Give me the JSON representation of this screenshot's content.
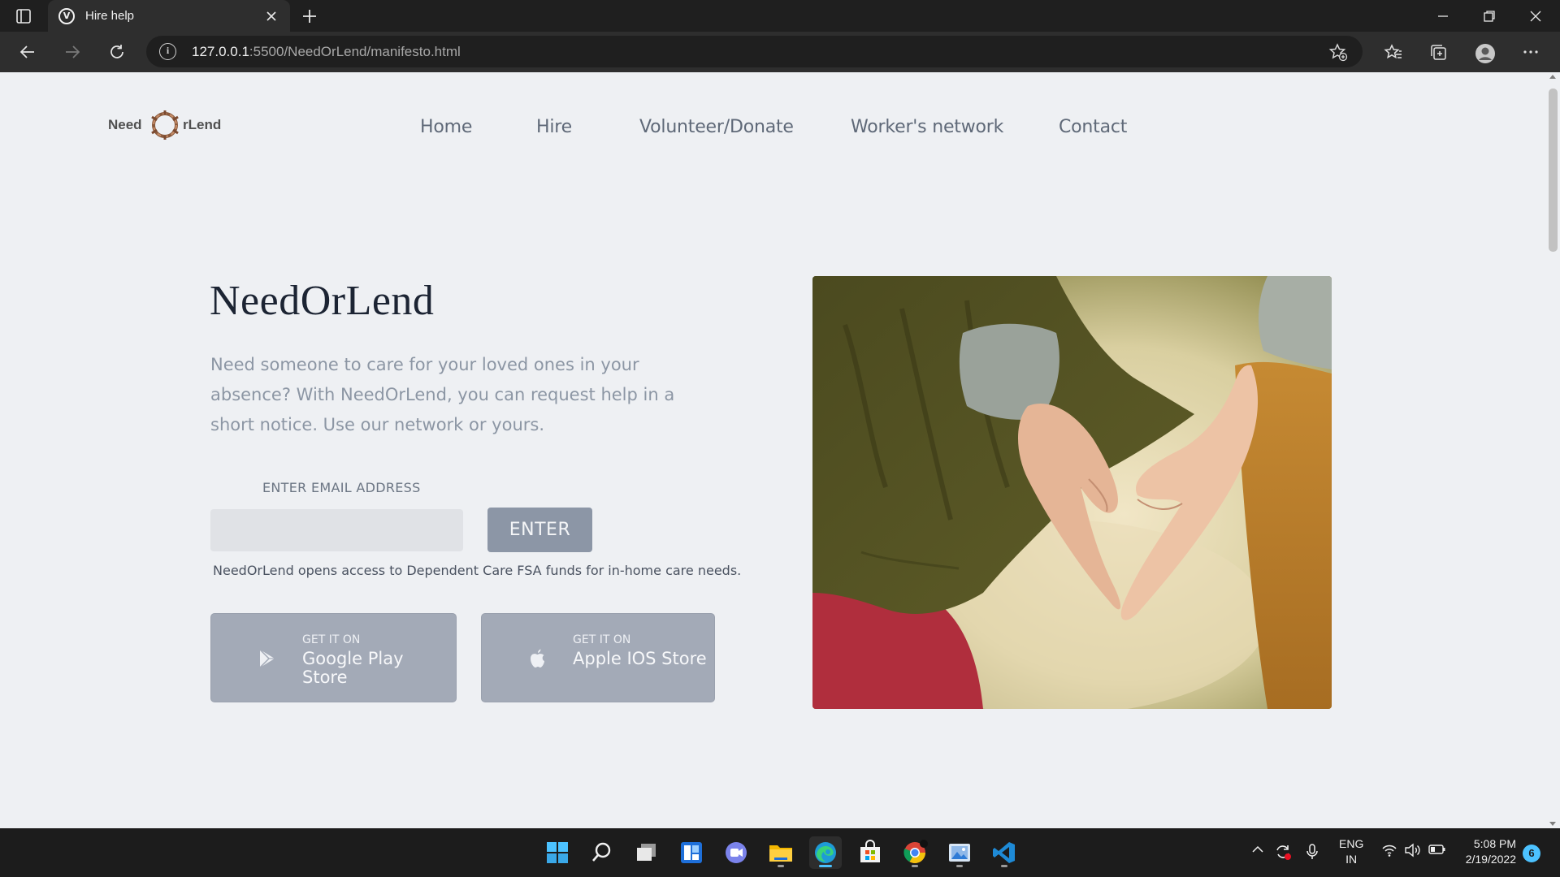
{
  "browser": {
    "tab": {
      "favicon_letter": "V",
      "title": "Hire help"
    },
    "address": {
      "host": "127.0.0.1",
      "rest": ":5500/NeedOrLend/manifesto.html"
    }
  },
  "page": {
    "logo": {
      "part1": "Need",
      "part2": "rLend"
    },
    "nav": [
      "Home",
      "Hire",
      "Volunteer/Donate",
      "Worker's network",
      "Contact"
    ],
    "hero": {
      "title": "NeedOrLend",
      "description": "Need someone to care for your loved ones in your absence? With NeedOrLend, you can request help in a short notice. Use our network or yours.",
      "email_label": "ENTER EMAIL ADDRESS",
      "email_placeholder": "",
      "enter_button": "ENTER",
      "note": "NeedOrLend opens access to Dependent Care FSA funds for in-home care needs."
    },
    "stores": [
      {
        "small": "GET IT ON",
        "big": "Google Play Store",
        "icon": "play-icon"
      },
      {
        "small": "GET IT ON",
        "big": "Apple IOS Store",
        "icon": "apple-icon"
      }
    ],
    "image": {
      "subject": "heart-hands-photo"
    }
  },
  "taskbar": {
    "language": {
      "line1": "ENG",
      "line2": "IN"
    },
    "time": "5:08 PM",
    "date": "2/19/2022",
    "notifications": "6"
  },
  "colors": {
    "accent": "#4cc2ff",
    "button": "#8c96a6",
    "page_bg": "#eef0f3"
  }
}
